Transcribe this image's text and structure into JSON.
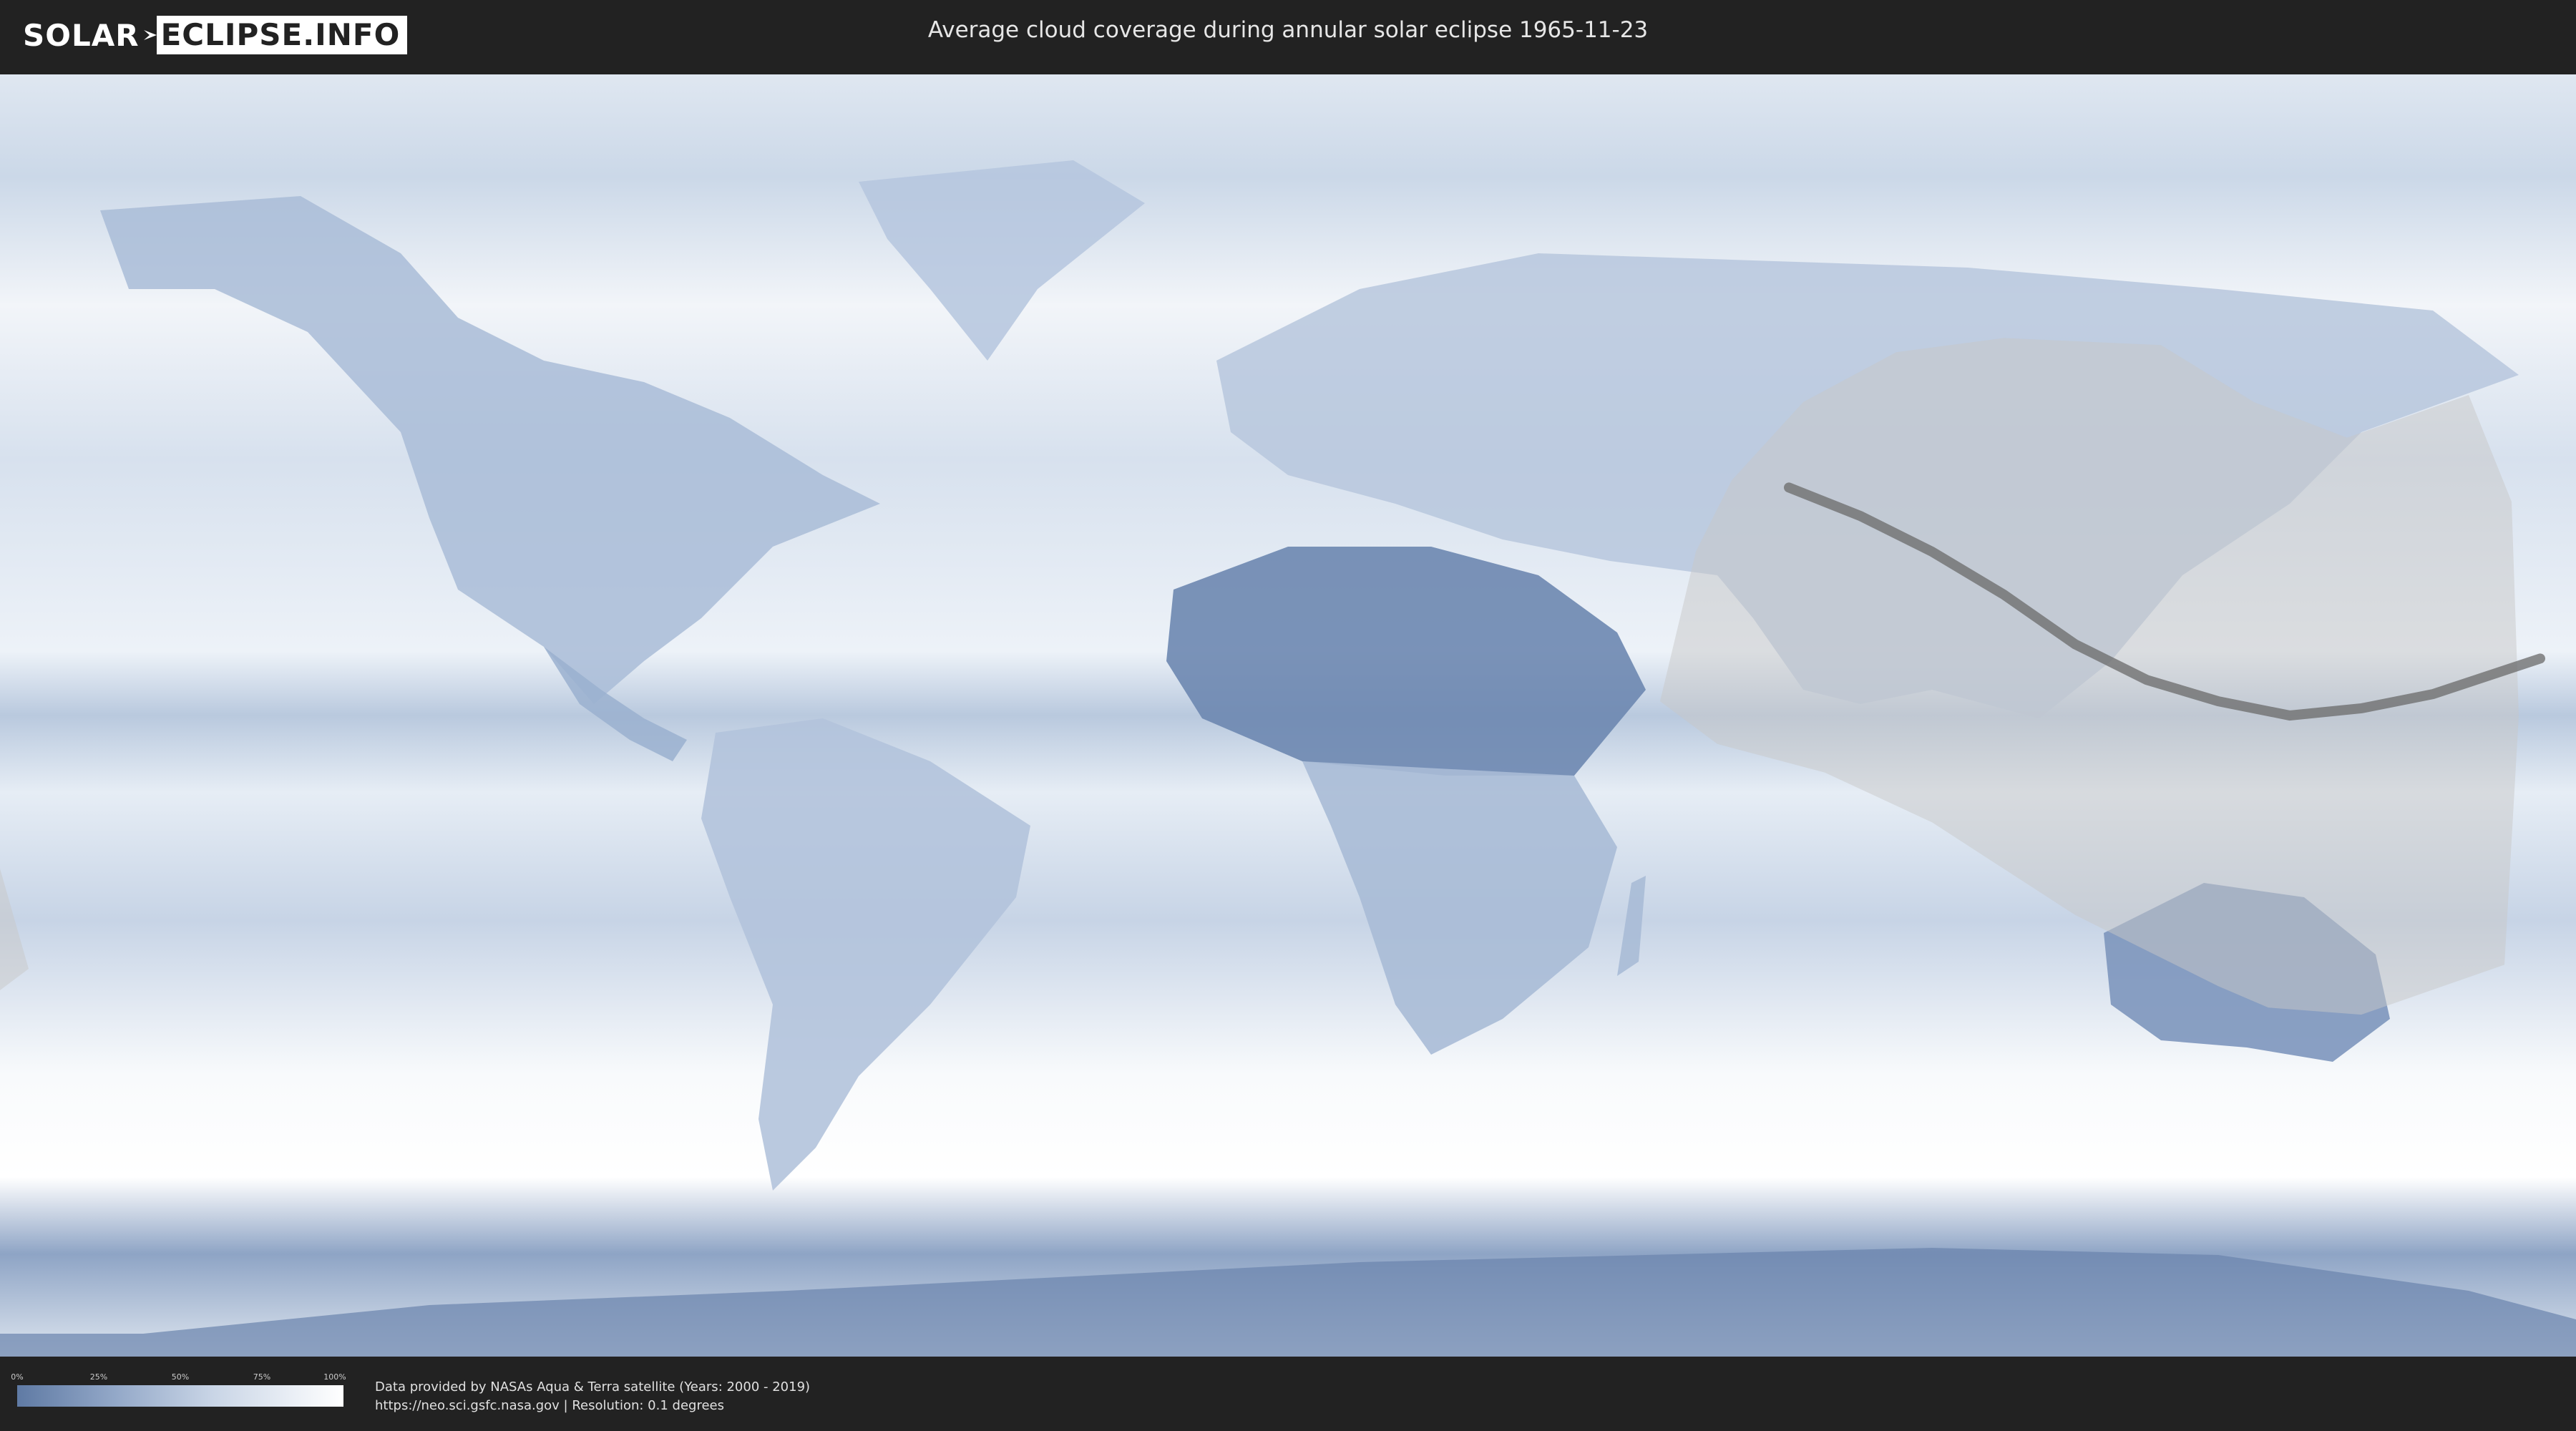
{
  "header": {
    "logo_left": "SOLAR",
    "logo_right": "ECLIPSE.INFO",
    "title": "Average cloud coverage during annular solar eclipse 1965-11-23"
  },
  "map": {
    "projection": "equirectangular",
    "eclipse_date": "1965-11-23",
    "eclipse_type": "annular",
    "colors": {
      "clear": "#5f7aa4",
      "cloudy": "#ffffff",
      "eclipse_overlay": "#c8c8c8",
      "central_path": "#6a6a6a",
      "borders": "#555555"
    },
    "central_path_lonlat": [
      [
        70,
        32
      ],
      [
        80,
        28
      ],
      [
        90,
        23
      ],
      [
        100,
        17
      ],
      [
        110,
        10
      ],
      [
        120,
        5
      ],
      [
        130,
        2
      ],
      [
        140,
        0
      ],
      [
        150,
        1
      ],
      [
        160,
        3
      ],
      [
        175,
        8
      ]
    ],
    "penumbra_outline_lonlat": [
      [
        52,
        2
      ],
      [
        57,
        23
      ],
      [
        62,
        33
      ],
      [
        72,
        44
      ],
      [
        85,
        51
      ],
      [
        100,
        53
      ],
      [
        122,
        52
      ],
      [
        135,
        44
      ],
      [
        148,
        39
      ],
      [
        165,
        45
      ],
      [
        171,
        30
      ],
      [
        172,
        0
      ],
      [
        170,
        -35
      ],
      [
        150,
        -42
      ],
      [
        137,
        -41
      ],
      [
        130,
        -38
      ],
      [
        110,
        -28
      ],
      [
        90,
        -15
      ],
      [
        75,
        -8
      ],
      [
        60,
        -4
      ],
      [
        52,
        2
      ]
    ]
  },
  "legend": {
    "ticks": [
      "0%",
      "25%",
      "50%",
      "75%",
      "100%"
    ]
  },
  "credits": {
    "line1": "Data provided by NASAs Aqua & Terra satellite (Years: 2000 - 2019)",
    "line2": "https://neo.sci.gsfc.nasa.gov | Resolution: 0.1 degrees"
  }
}
